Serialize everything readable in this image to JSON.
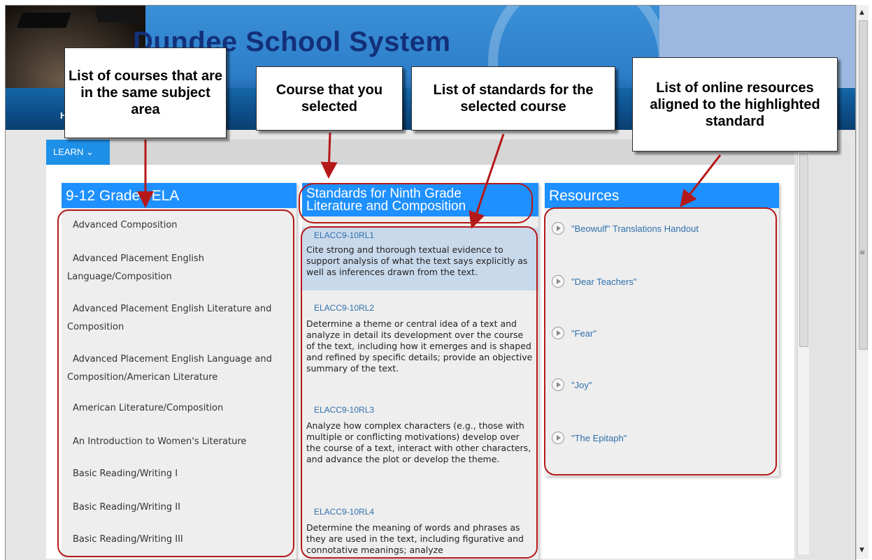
{
  "site": {
    "title": "Dundee School System",
    "nav_fragment": "H"
  },
  "learn_menu": {
    "label": "LEARN ⌄"
  },
  "courses_panel": {
    "heading": "9-12 Grades ELA",
    "items": [
      {
        "line1": "Advanced Composition",
        "line2": ""
      },
      {
        "line1": "Advanced Placement English",
        "line2": "Language/Composition"
      },
      {
        "line1": "Advanced Placement English Literature and",
        "line2": "Composition"
      },
      {
        "line1": "Advanced Placement English Language and",
        "line2": "Composition/American Literature"
      },
      {
        "line1": "American Literature/Composition",
        "line2": ""
      },
      {
        "line1": "An Introduction to Women's Literature",
        "line2": ""
      },
      {
        "line1": "Basic Reading/Writing I",
        "line2": ""
      },
      {
        "line1": "Basic Reading/Writing II",
        "line2": ""
      },
      {
        "line1": "Basic Reading/Writing III",
        "line2": ""
      }
    ]
  },
  "standards_panel": {
    "heading_line1": "Standards for Ninth Grade",
    "heading_line2": "Literature and Composition",
    "items": [
      {
        "code": "ELACC9-10RL1",
        "desc": "Cite strong and thorough textual evidence to support analysis of what the text says explicitly as well as inferences drawn from the text.",
        "selected": true
      },
      {
        "code": "ELACC9-10RL2",
        "desc": "Determine a theme or central idea of a text and analyze in detail its development over the course of the text, including how it emerges and is shaped and refined by specific details; provide an objective summary of the text.",
        "selected": false
      },
      {
        "code": "ELACC9-10RL3",
        "desc": "Analyze how complex characters (e.g., those with multiple or conflicting motivations) develop over the course of a text, interact with other characters, and advance the plot or develop the theme.",
        "selected": false
      },
      {
        "code": "ELACC9-10RL4",
        "desc": "Determine the meaning of words and phrases as they are used in the text, including figurative and connotative meanings; analyze",
        "selected": false
      }
    ]
  },
  "resources_panel": {
    "heading": "Resources",
    "items": [
      {
        "label": "\"Beowulf\" Translations Handout",
        "icon": "play-circle-icon"
      },
      {
        "label": "\"Dear Teachers\"",
        "icon": "play-circle-icon"
      },
      {
        "label": "\"Fear\"",
        "icon": "play-circle-icon"
      },
      {
        "label": "\"Joy\"",
        "icon": "play-circle-icon"
      },
      {
        "label": "\"The Epitaph\"",
        "icon": "play-circle-icon"
      }
    ]
  },
  "callouts": {
    "courses": "List of courses that are in the same subject area",
    "selected_course": "Course that you selected",
    "standards": "List of standards for the selected course",
    "resources": "List of online resources aligned to the highlighted standard"
  },
  "colors": {
    "panel_header": "#1e90ff",
    "highlight_ring": "#b51818",
    "link": "#2f6fad",
    "selected_row": "#c9d9ec"
  }
}
